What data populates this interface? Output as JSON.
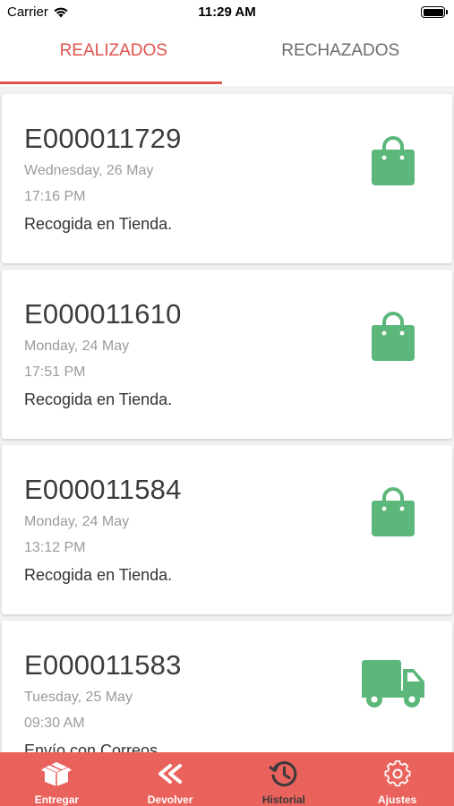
{
  "status_bar": {
    "carrier": "Carrier",
    "time": "11:29 AM"
  },
  "tabs": [
    {
      "label": "REALIZADOS",
      "active": true
    },
    {
      "label": "RECHAZADOS",
      "active": false
    }
  ],
  "orders": [
    {
      "code": "E000011729",
      "date": "Wednesday, 26 May",
      "time": "17:16 PM",
      "method": "Recogida en Tienda.",
      "icon": "shopping-bag-icon"
    },
    {
      "code": "E000011610",
      "date": "Monday, 24 May",
      "time": "17:51 PM",
      "method": "Recogida en Tienda.",
      "icon": "shopping-bag-icon"
    },
    {
      "code": "E000011584",
      "date": "Monday, 24 May",
      "time": "13:12 PM",
      "method": "Recogida en Tienda.",
      "icon": "shopping-bag-icon"
    },
    {
      "code": "E000011583",
      "date": "Tuesday, 25 May",
      "time": "09:30 AM",
      "method": "Envío con Correos.",
      "icon": "delivery-truck-icon"
    }
  ],
  "bottom_nav": [
    {
      "label": "Entregar",
      "icon": "package-icon",
      "active": false
    },
    {
      "label": "Devolver",
      "icon": "double-chevron-left-icon",
      "active": false
    },
    {
      "label": "Historial",
      "icon": "history-clock-icon",
      "active": true
    },
    {
      "label": "Ajustes",
      "icon": "gear-icon",
      "active": false
    }
  ],
  "colors": {
    "accent": "#e0534d",
    "bottom_bar": "#ea625c",
    "icon_green": "#5cb87a",
    "active_nav": "#3a3a3a"
  }
}
